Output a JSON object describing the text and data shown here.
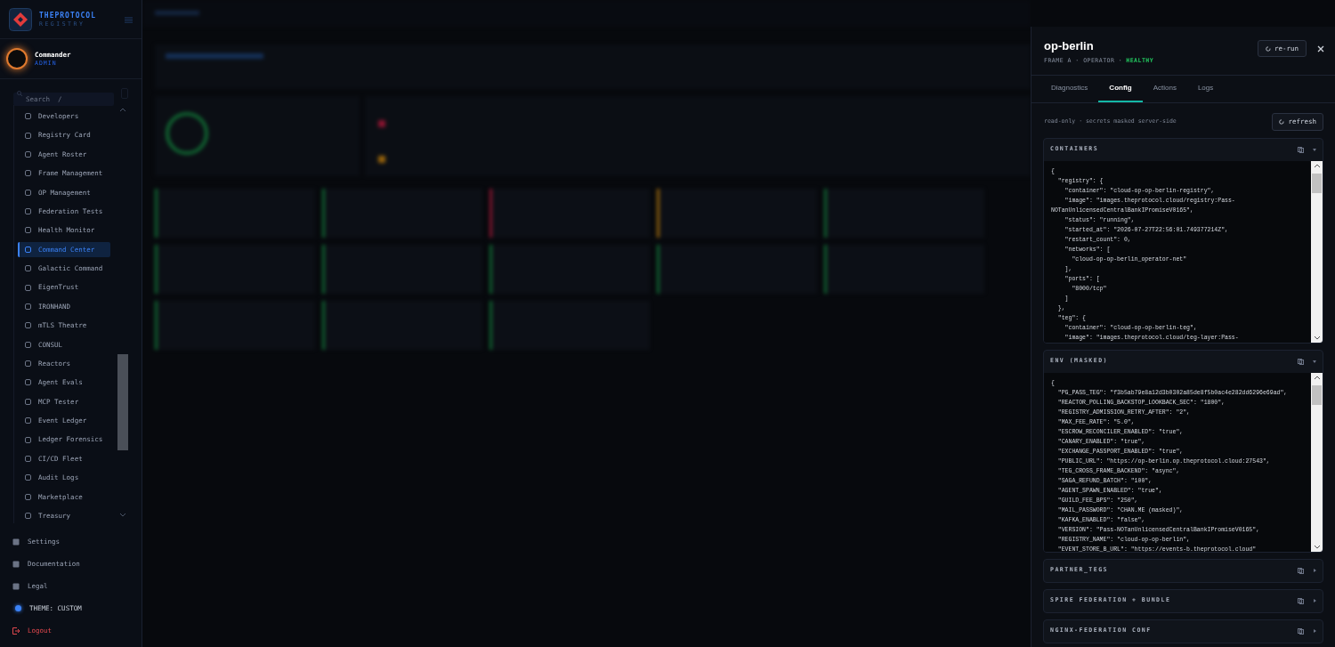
{
  "sidebar": {
    "brand": {
      "name": "THEPROTOCOL",
      "subtitle": "REGISTRY"
    },
    "user": {
      "name": "Commander",
      "role": "ADMIN"
    },
    "search": {
      "placeholder": "Search  /"
    },
    "nav_items": [
      {
        "label": "Developers",
        "selected": false
      },
      {
        "label": "Registry Card",
        "selected": false
      },
      {
        "label": "Agent Roster",
        "selected": false
      },
      {
        "label": "Frame Management",
        "selected": false
      },
      {
        "label": "OP Management",
        "selected": false
      },
      {
        "label": "Federation Tests",
        "selected": false
      },
      {
        "label": "Health Monitor",
        "selected": false
      },
      {
        "label": "Command Center",
        "selected": true
      },
      {
        "label": "Galactic Command",
        "selected": false
      },
      {
        "label": "EigenTrust",
        "selected": false
      },
      {
        "label": "IRONHAND",
        "selected": false
      },
      {
        "label": "mTLS Theatre",
        "selected": false
      },
      {
        "label": "CONSUL",
        "selected": false
      },
      {
        "label": "Reactors",
        "selected": false
      },
      {
        "label": "Agent Evals",
        "selected": false
      },
      {
        "label": "MCP Tester",
        "selected": false
      },
      {
        "label": "Event Ledger",
        "selected": false
      },
      {
        "label": "Ledger Forensics",
        "selected": false
      },
      {
        "label": "CI/CD Fleet",
        "selected": false
      },
      {
        "label": "Audit Logs",
        "selected": false
      },
      {
        "label": "Marketplace",
        "selected": false
      },
      {
        "label": "Treasury",
        "selected": false
      }
    ],
    "footer_items": [
      {
        "label": "Settings",
        "kind": "link"
      },
      {
        "label": "Documentation",
        "kind": "link"
      },
      {
        "label": "Legal",
        "kind": "link"
      },
      {
        "label": "THEME: CUSTOM",
        "kind": "theme"
      },
      {
        "label": "Logout",
        "kind": "logout"
      }
    ]
  },
  "panel": {
    "title": "op-berlin",
    "meta": "FRAME A · OPERATOR ·",
    "status": "HEALTHY",
    "rerun_button": "re-run",
    "tabs": [
      {
        "label": "Diagnostics",
        "selected": false
      },
      {
        "label": "Config",
        "selected": true
      },
      {
        "label": "Actions",
        "selected": false
      },
      {
        "label": "Logs",
        "selected": false
      }
    ],
    "note": "read-only · secrets masked server-side",
    "refresh_button": "refresh",
    "sections": [
      {
        "title": "CONTAINERS",
        "expanded": true,
        "lines": [
          "{",
          "  \"registry\": {",
          "    \"container\": \"cloud-op-op-berlin-registry\",",
          "    \"image\": \"images.theprotocol.cloud/registry:Pass-",
          "NOTanUnlicensedCentralBankIPromiseV0165\",",
          "    \"status\": \"running\",",
          "    \"started_at\": \"2026-07-27T22:56:01.749377214Z\",",
          "    \"restart_count\": 0,",
          "    \"networks\": [",
          "      \"cloud-op-op-berlin_operator-net\"",
          "    ],",
          "    \"ports\": [",
          "      \"8000/tcp\"",
          "    ]",
          "  },",
          "  \"teg\": {",
          "    \"container\": \"cloud-op-op-berlin-teg\",",
          "    \"image\": \"images.theprotocol.cloud/teg-layer:Pass-"
        ]
      },
      {
        "title": "ENV (MASKED)",
        "expanded": true,
        "lines": [
          "{",
          "  \"PG_PASS_TEG\": \"f3b5ab79e8a12d3b0302a85de8f5b0ac4e282dd6296e69ad\",",
          "  \"REACTOR_POLLING_BACKSTOP_LOOKBACK_SEC\": \"1800\",",
          "  \"REGISTRY_ADMISSION_RETRY_AFTER\": \"2\",",
          "  \"MAX_FEE_RATE\": \"5.0\",",
          "  \"ESCROW_RECONCILER_ENABLED\": \"true\",",
          "  \"CANARY_ENABLED\": \"true\",",
          "  \"EXCHANGE_PASSPORT_ENABLED\": \"true\",",
          "  \"PUBLIC_URL\": \"https://op-berlin.op.theprotocol.cloud:27543\",",
          "  \"TEG_CROSS_FRAME_BACKEND\": \"async\",",
          "  \"SAGA_REFUND_BATCH\": \"100\",",
          "  \"AGENT_SPAWN_ENABLED\": \"true\",",
          "  \"GUILD_FEE_BPS\": \"250\",",
          "  \"MAIL_PASSWORD\": \"CHAN.ME (masked)\",",
          "  \"KAFKA_ENABLED\": \"false\",",
          "  \"VERSION\": \"Pass-NOTanUnlicensedCentralBankIPromiseV0165\",",
          "  \"REGISTRY_NAME\": \"cloud-op-op-berlin\",",
          "  \"EVENT_STORE_B_URL\": \"https://events-b.theprotocol.cloud\""
        ]
      },
      {
        "title": "PARTNER_TEGS",
        "expanded": false
      },
      {
        "title": "SPIRE FEDERATION + BUNDLE",
        "expanded": false
      },
      {
        "title": "NGINX-FEDERATION CONF",
        "expanded": false
      }
    ]
  }
}
